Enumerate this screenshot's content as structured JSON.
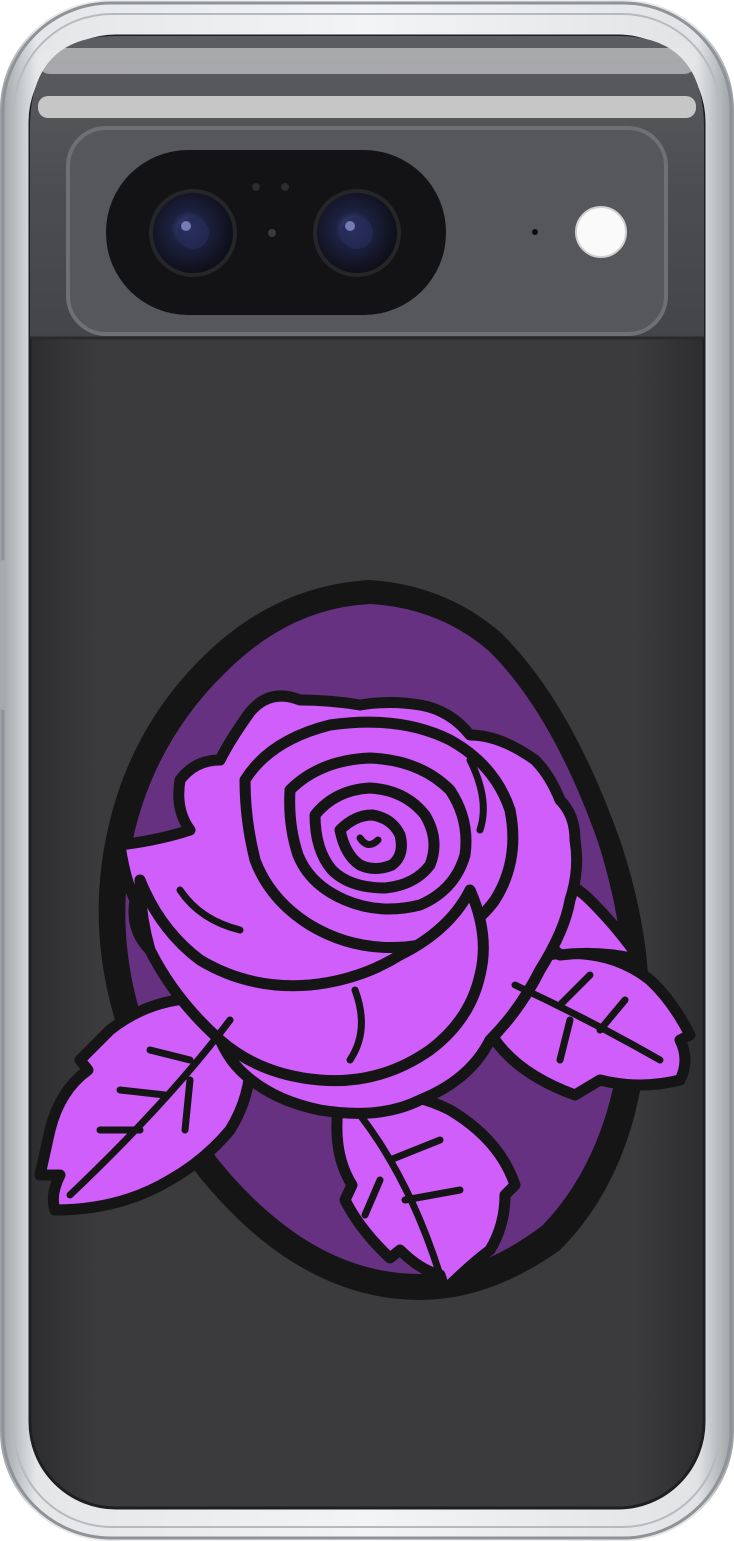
{
  "colors": {
    "background": "#ffffff",
    "case_frame": "#cfd2d5",
    "case_frame_edge": "#8f9398",
    "phone_body": "#3b3b3d",
    "phone_body_dark": "#2e2e30",
    "camera_bar": "#4a4b4e",
    "lens_housing": "#141416",
    "lens_glass": "#1c1f33",
    "flash": "#fafafa",
    "art_outline": "#151515",
    "art_background": "#663181",
    "rose_fill": "#cf5efa"
  },
  "icons": {
    "camera": "camera-lens-icon",
    "flash": "flash-icon",
    "rose": "rose-illustration"
  }
}
